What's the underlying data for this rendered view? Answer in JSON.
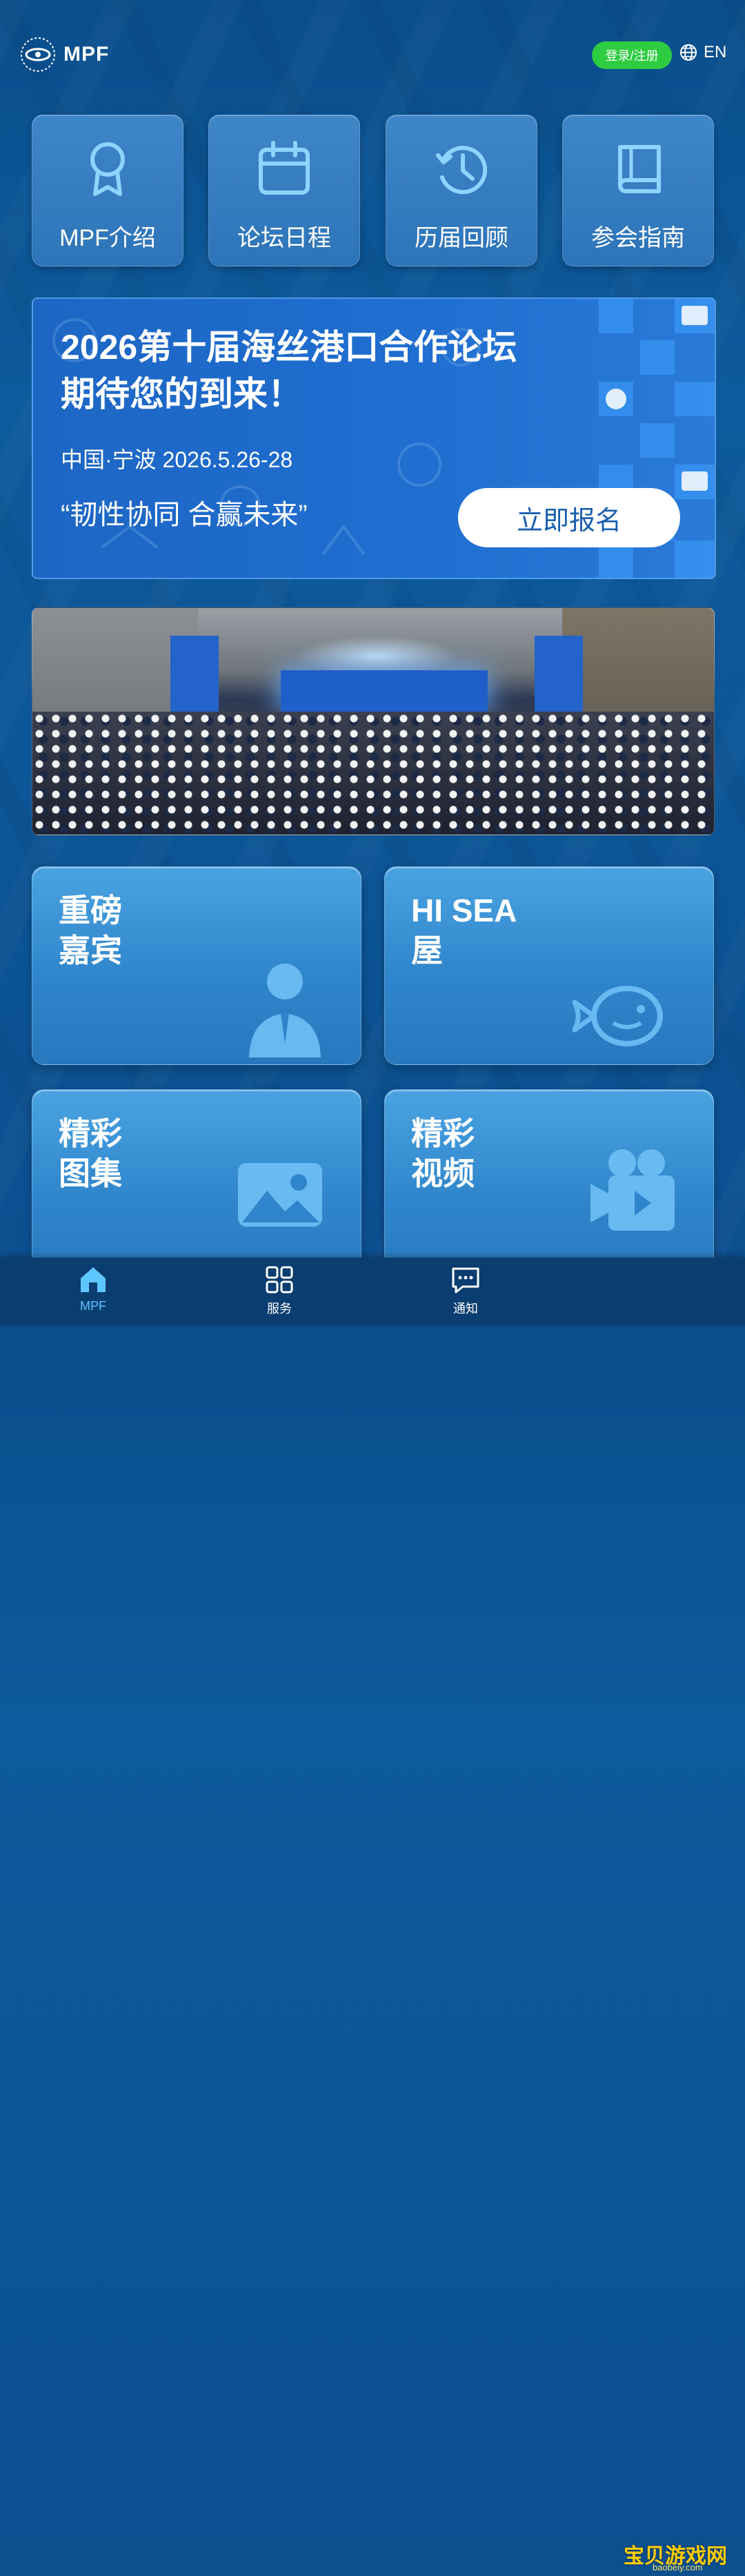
{
  "header": {
    "logo_text": "MPF",
    "login_label": "登录/注册",
    "lang_label": "EN"
  },
  "quick_tiles": [
    {
      "label": "MPF介绍",
      "icon": "award-ribbon-icon"
    },
    {
      "label": "论坛日程",
      "icon": "calendar-icon"
    },
    {
      "label": "历届回顾",
      "icon": "history-clock-icon"
    },
    {
      "label": "参会指南",
      "icon": "book-icon"
    }
  ],
  "banner": {
    "title_line1": "2026第十届海丝港口合作论坛",
    "title_line2": "期待您的到来！",
    "place_date": "中国·宁波 2026.5.26-28",
    "slogan": "“韧性协同 合赢未来”",
    "cta_label": "立即报名"
  },
  "cards": [
    {
      "line1": "重磅",
      "line2": "嘉宾",
      "icon": "business-person-icon"
    },
    {
      "line1": "HI SEA",
      "line2": "屋",
      "icon": "fish-mascot-icon"
    },
    {
      "line1": "精彩",
      "line2": "图集",
      "icon": "image-gallery-icon"
    },
    {
      "line1": "精彩",
      "line2": "视频",
      "icon": "video-camera-icon"
    }
  ],
  "tabbar": [
    {
      "label": "MPF",
      "icon": "home-icon",
      "active": true
    },
    {
      "label": "服务",
      "icon": "grid-icon",
      "active": false
    },
    {
      "label": "通知",
      "icon": "message-icon",
      "active": false
    }
  ],
  "watermark": {
    "text": "宝贝游戏网",
    "sub": "baobeiy.com"
  },
  "colors": {
    "background": "#0c4f8f",
    "login_green": "#2ecc40",
    "banner_blue": "#1f6ed0",
    "active_tab": "#5ec6ff"
  }
}
